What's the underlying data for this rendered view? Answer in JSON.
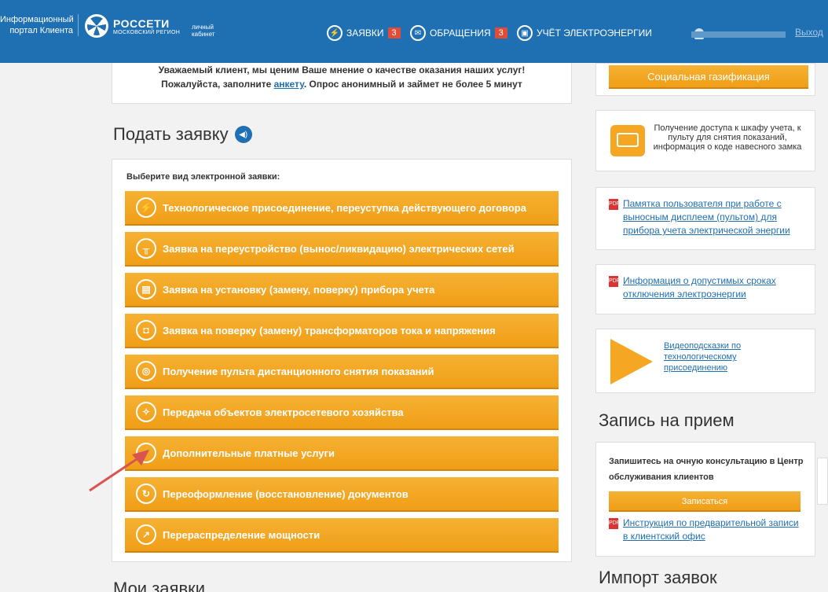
{
  "header": {
    "portal_line1": "Информационный",
    "portal_line2": "портал Клиента",
    "brand": "РОССЕТИ",
    "brand_sub": "МОСКОВСКИЙ РЕГИОН",
    "cabinet_line1": "личный",
    "cabinet_line2": "кабинет",
    "nav": [
      {
        "label": "ЗАЯВКИ",
        "badge": "3"
      },
      {
        "label": "ОБРАЩЕНИЯ",
        "badge": "3"
      },
      {
        "label": "УЧЁТ ЭЛЕКТРОЭНЕРГИИ"
      }
    ],
    "logout": "Выход"
  },
  "notice": {
    "line1": "Уважаемый клиент, мы ценим Ваше мнение о качестве оказания наших услуг!",
    "line2_pre": "Пожалуйста, заполните ",
    "line2_link": "анкету",
    "line2_post": ". Опрос анонимный и займет не более 5 минут"
  },
  "submit": {
    "title": "Подать заявку",
    "caption": "Выберите вид электронной заявки:",
    "buttons": [
      "Технологическое присоединение, переуступка действующего договора",
      "Заявка на переустройство (вынос/ликвидацию) электрических сетей",
      "Заявка на установку (замену, поверку) прибора учета",
      "Заявка на поверку (замену) трансформаторов тока и напряжения",
      "Получение пульта дистанционного снятия показаний",
      "Передача объектов электросетевого хозяйства",
      "Дополнительные платные услуги",
      "Переоформление (восстановление) документов",
      "Перераспределение мощности"
    ]
  },
  "my_requests_title": "Мои заявки",
  "right": {
    "gasification": "Социальная газификация",
    "cabinet_access": "Получение доступа к шкафу учета, к пульту для снятия показаний, информация о коде навесного замка",
    "memo_doc": "Памятка пользователя при работе с выносным дисплеем (пультом) для прибора учета электрической энергии",
    "outage_doc": "Информация о допустимых сроках отключения электроэнергии",
    "video": "Видеоподсказки по технологическому присоединению",
    "appointment_title": "Запись на прием",
    "appointment_text": "Запишитесь на очную консультацию в Центр обслуживания клиентов",
    "appointment_button": "Записаться",
    "appointment_doc": "Инструкция по предварительной записи в клиентский офис",
    "import_title": "Импорт заявок"
  }
}
